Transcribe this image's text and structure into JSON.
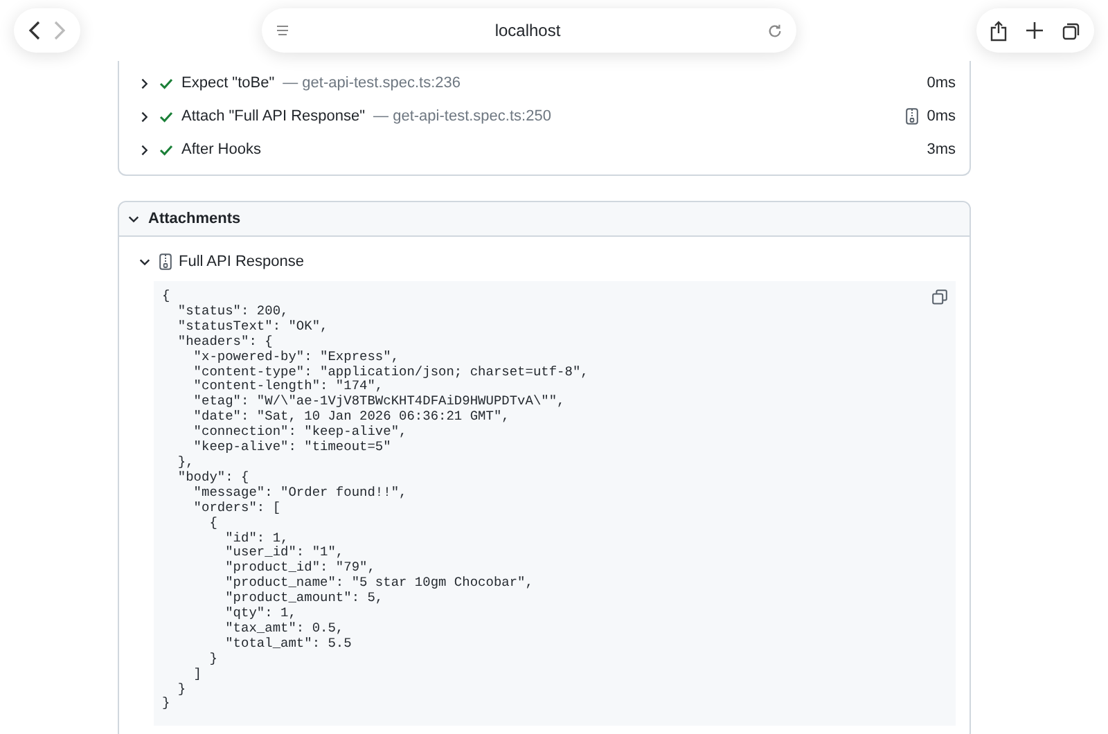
{
  "browser": {
    "address": "localhost"
  },
  "steps": [
    {
      "title": "Expect \"toBe\"",
      "location": "— get-api-test.spec.ts:236",
      "duration": "0ms",
      "passed": true,
      "expanded": false,
      "has_attachment": false
    },
    {
      "title": "Attach \"Full API Response\"",
      "location": "— get-api-test.spec.ts:250",
      "duration": "0ms",
      "passed": true,
      "expanded": false,
      "has_attachment": true
    },
    {
      "title": "After Hooks",
      "duration": "3ms",
      "passed": true,
      "expanded": false,
      "has_attachment": false
    }
  ],
  "attachments": {
    "title": "Attachments",
    "expanded": true,
    "items": [
      {
        "name": "Full API Response",
        "expanded": true,
        "content": "{\n  \"status\": 200,\n  \"statusText\": \"OK\",\n  \"headers\": {\n    \"x-powered-by\": \"Express\",\n    \"content-type\": \"application/json; charset=utf-8\",\n    \"content-length\": \"174\",\n    \"etag\": \"W/\\\"ae-1VjV8TBWcKHT4DFAiD9HWUPDTvA\\\"\",\n    \"date\": \"Sat, 10 Jan 2026 06:36:21 GMT\",\n    \"connection\": \"keep-alive\",\n    \"keep-alive\": \"timeout=5\"\n  },\n  \"body\": {\n    \"message\": \"Order found!!\",\n    \"orders\": [\n      {\n        \"id\": 1,\n        \"user_id\": \"1\",\n        \"product_id\": \"79\",\n        \"product_name\": \"5 star 10gm Chocobar\",\n        \"product_amount\": 5,\n        \"qty\": 1,\n        \"tax_amt\": 0.5,\n        \"total_amt\": 5.5\n      }\n    ]\n  }\n}"
      }
    ]
  }
}
